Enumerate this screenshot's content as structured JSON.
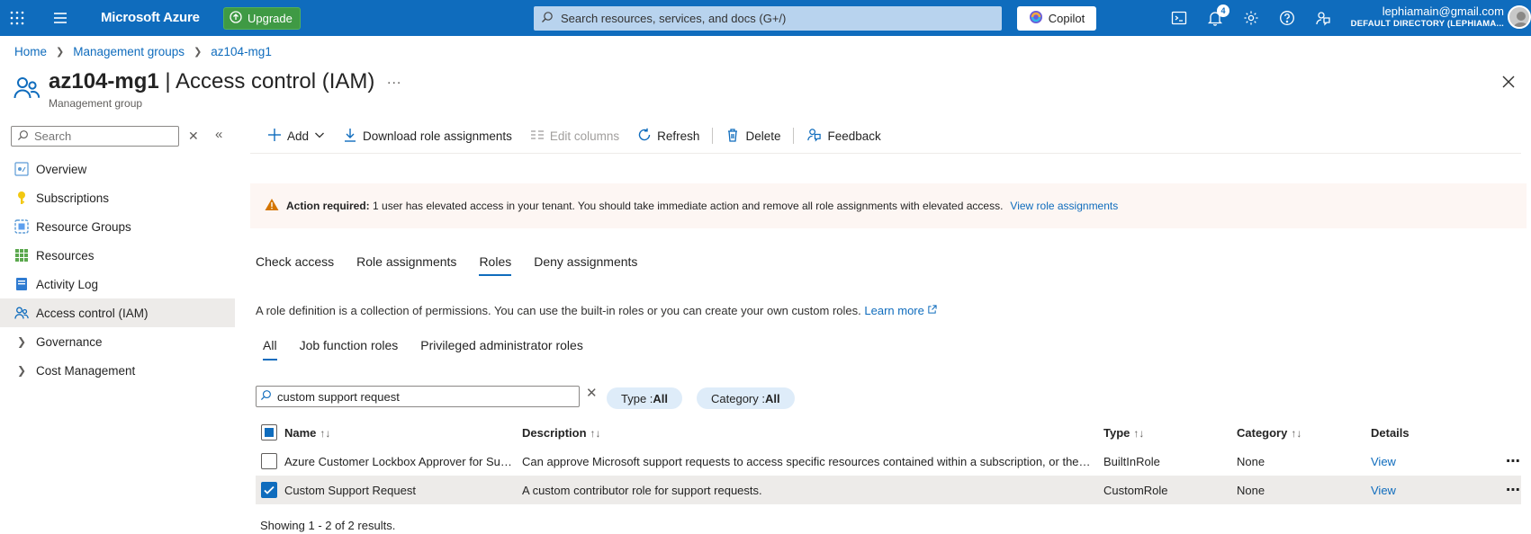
{
  "topbar": {
    "brand": "Microsoft Azure",
    "upgrade_label": "Upgrade",
    "search_placeholder": "Search resources, services, and docs (G+/)",
    "copilot_label": "Copilot",
    "notification_count": "4",
    "account_email": "lephiamain@gmail.com",
    "account_directory": "DEFAULT DIRECTORY (LEPHIAMA..."
  },
  "breadcrumb": [
    "Home",
    "Management groups",
    "az104-mg1"
  ],
  "page": {
    "title_resource": "az104-mg1",
    "title_separator": " | ",
    "title_blade": "Access control (IAM)",
    "subtitle": "Management group",
    "more": "..."
  },
  "sidebar": {
    "search_placeholder": "Search",
    "items": [
      {
        "label": "Overview",
        "icon": "overview-icon"
      },
      {
        "label": "Subscriptions",
        "icon": "key-icon"
      },
      {
        "label": "Resource Groups",
        "icon": "resource-group-icon"
      },
      {
        "label": "Resources",
        "icon": "grid-icon"
      },
      {
        "label": "Activity Log",
        "icon": "activity-log-icon"
      },
      {
        "label": "Access control (IAM)",
        "icon": "people-icon",
        "active": true
      },
      {
        "label": "Governance",
        "icon": "chevron-right-icon"
      },
      {
        "label": "Cost Management",
        "icon": "chevron-right-icon"
      }
    ]
  },
  "toolbar": {
    "add": "Add",
    "download": "Download role assignments",
    "edit_columns": "Edit columns",
    "refresh": "Refresh",
    "delete": "Delete",
    "feedback": "Feedback"
  },
  "warning": {
    "bold": "Action required:",
    "text": " 1 user has elevated access in your tenant. You should take immediate action and remove all role assignments with elevated access.",
    "link": "View role assignments"
  },
  "tabs": [
    "Check access",
    "Role assignments",
    "Roles",
    "Deny assignments"
  ],
  "active_tab": "Roles",
  "description": {
    "text": "A role definition is a collection of permissions. You can use the built-in roles or you can create your own custom roles.",
    "link": "Learn more"
  },
  "subtabs": [
    "All",
    "Job function roles",
    "Privileged administrator roles"
  ],
  "filter": {
    "value": "custom support request",
    "type_label": "Type : ",
    "type_value": "All",
    "category_label": "Category : ",
    "category_value": "All"
  },
  "table": {
    "columns": [
      "Name",
      "Description",
      "Type",
      "Category",
      "Details"
    ],
    "rows": [
      {
        "name": "Azure Customer Lockbox Approver for Sub...",
        "description": "Can approve Microsoft support requests to access specific resources contained within a subscription, or the s...",
        "type": "BuiltInRole",
        "category": "None",
        "details": "View",
        "checked": false
      },
      {
        "name": "Custom Support Request",
        "description": "A custom contributor role for support requests.",
        "type": "CustomRole",
        "category": "None",
        "details": "View",
        "checked": true
      }
    ],
    "results": "Showing 1 - 2 of 2 results."
  },
  "colors": {
    "topbar": "#0f6cbd",
    "upgrade": "#3f9a44",
    "link": "#0f6cbd",
    "warning_bg": "#fdf6f3",
    "warning_icon": "#d47500"
  }
}
